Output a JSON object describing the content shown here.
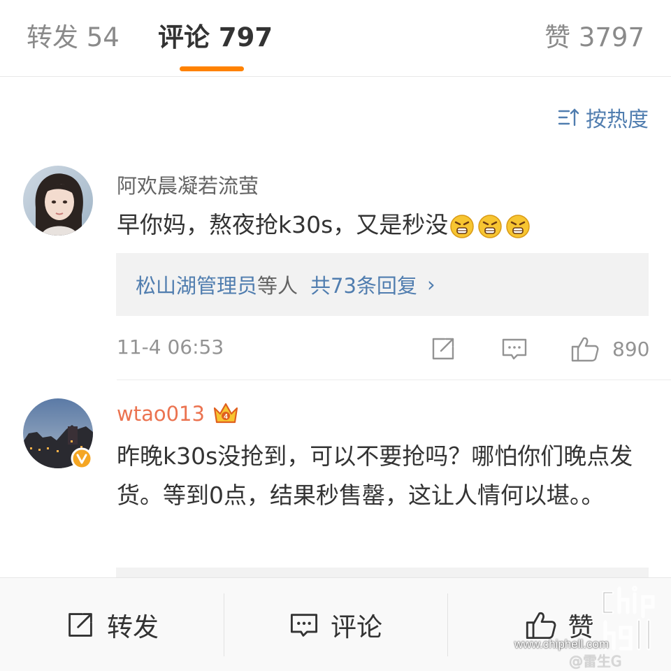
{
  "tabs": {
    "repost": "转发 54",
    "comment": "评论 797",
    "likes": "赞 3797",
    "accent_color": "#ff8200"
  },
  "sort": {
    "icon": "sort-icon",
    "label": "按热度"
  },
  "comments": [
    {
      "username": "阿欢晨凝若流萤",
      "text": "早你妈，熬夜抢k30s，又是秒没",
      "emojis": [
        "angry-emoji",
        "angry-emoji",
        "angry-emoji"
      ],
      "replies": {
        "who": "松山湖管理员",
        "mid": "等人",
        "count": "共73条回复",
        "chevron": "›"
      },
      "time": "11-4 06:53",
      "like_count": "890"
    },
    {
      "username": "wtao013",
      "badge": "vip-crown-icon",
      "verified": "verified-v-icon",
      "text": "昨晚k30s没抢到，可以不要抢吗？哪怕你们晚点发货。等到0点，结果秒售罄，这让人情何以堪。。"
    }
  ],
  "bottom_bar": {
    "repost": "转发",
    "comment": "评论",
    "like": "赞"
  },
  "watermark": {
    "url": "www.chiphell.com",
    "user": "@雷生G"
  },
  "colors": {
    "link": "#507daf",
    "vip_name": "#eb7350",
    "muted": "#939393"
  }
}
